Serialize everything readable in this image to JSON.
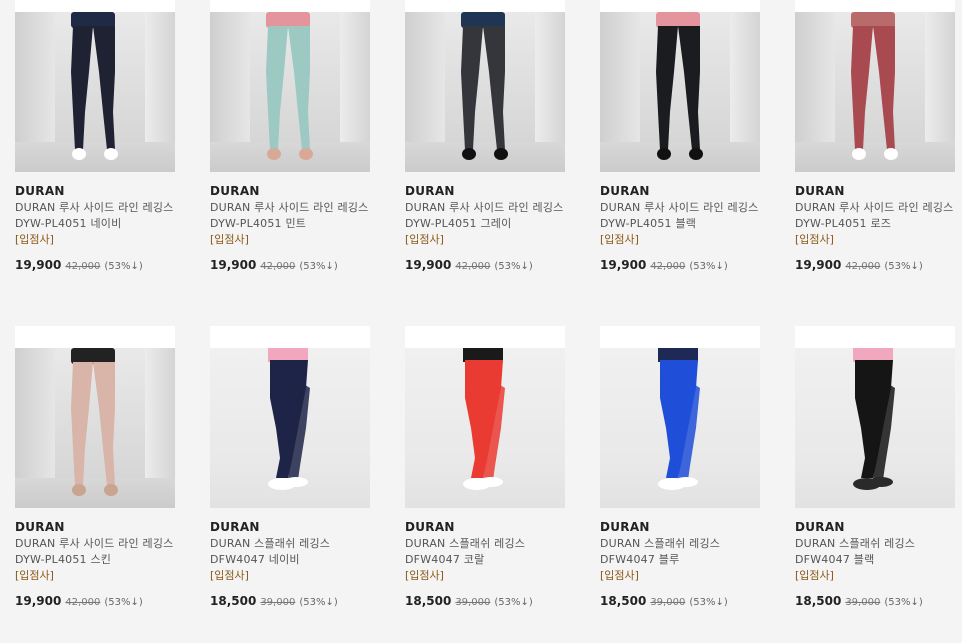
{
  "products": [
    {
      "brand": "DURAN",
      "name": "DURAN 루사 사이드 라인 레깅스 DYW-PL4051 네이비",
      "tag": "[입점사]",
      "price": "19,900",
      "original": "42,000",
      "discount": "(53%↓)",
      "top": "#1f2a44",
      "legs": "#1e2233",
      "shoes": "#ffffff",
      "scene": "studio"
    },
    {
      "brand": "DURAN",
      "name": "DURAN 루사 사이드 라인 레깅스 DYW-PL4051 민트",
      "tag": "[입점사]",
      "price": "19,900",
      "original": "42,000",
      "discount": "(53%↓)",
      "top": "#e3949c",
      "legs": "#9cc9c2",
      "shoes": "#d8a996",
      "scene": "studio"
    },
    {
      "brand": "DURAN",
      "name": "DURAN 루사 사이드 라인 레깅스 DYW-PL4051 그레이",
      "tag": "[입점사]",
      "price": "19,900",
      "original": "42,000",
      "discount": "(53%↓)",
      "top": "#1f3554",
      "legs": "#34363c",
      "shoes": "#111111",
      "scene": "studio"
    },
    {
      "brand": "DURAN",
      "name": "DURAN 루사 사이드 라인 레깅스 DYW-PL4051 블랙",
      "tag": "[입점사]",
      "price": "19,900",
      "original": "42,000",
      "discount": "(53%↓)",
      "top": "#e3949c",
      "legs": "#1b1c1f",
      "shoes": "#111111",
      "scene": "studio"
    },
    {
      "brand": "DURAN",
      "name": "DURAN 루사 사이드 라인 레깅스 DYW-PL4051 로즈",
      "tag": "[입점사]",
      "price": "19,900",
      "original": "42,000",
      "discount": "(53%↓)",
      "top": "#b96a6a",
      "legs": "#a84a50",
      "shoes": "#ffffff",
      "scene": "studio"
    },
    {
      "brand": "DURAN",
      "name": "DURAN 루사 사이드 라인 레깅스 DYW-PL4051 스킨",
      "tag": "[입점사]",
      "price": "19,900",
      "original": "42,000",
      "discount": "(53%↓)",
      "top": "#222222",
      "legs": "#d8b5a8",
      "shoes": "#c9a48e",
      "scene": "studio"
    },
    {
      "brand": "DURAN",
      "name": "DURAN 스플래쉬 레깅스 DFW4047 네이비",
      "tag": "[입점사]",
      "price": "18,500",
      "original": "39,000",
      "discount": "(53%↓)",
      "top": "#f1a7bd",
      "legs": "#1d2447",
      "shoes": "#ffffff",
      "scene": "plain"
    },
    {
      "brand": "DURAN",
      "name": "DURAN 스플래쉬 레깅스 DFW4047 코랄",
      "tag": "[입점사]",
      "price": "18,500",
      "original": "39,000",
      "discount": "(53%↓)",
      "top": "#1a1a1a",
      "legs": "#ea3b32",
      "shoes": "#ffffff",
      "scene": "plain"
    },
    {
      "brand": "DURAN",
      "name": "DURAN 스플래쉬 레깅스 DFW4047 블루",
      "tag": "[입점사]",
      "price": "18,500",
      "original": "39,000",
      "discount": "(53%↓)",
      "top": "#1e2a55",
      "legs": "#1f4fd8",
      "shoes": "#ffffff",
      "scene": "plain"
    },
    {
      "brand": "DURAN",
      "name": "DURAN 스플래쉬 레깅스 DFW4047 블랙",
      "tag": "[입점사]",
      "price": "18,500",
      "original": "39,000",
      "discount": "(53%↓)",
      "top": "#f1a7bd",
      "legs": "#151515",
      "shoes": "#2a2a2a",
      "scene": "plain"
    }
  ]
}
